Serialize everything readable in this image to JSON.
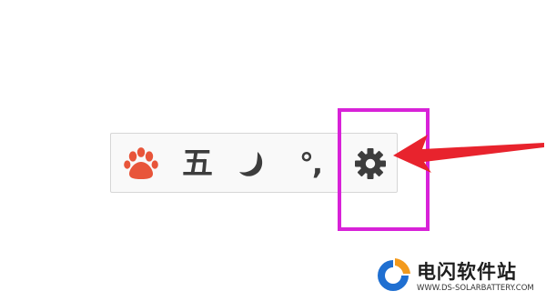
{
  "toolbar": {
    "wubi_label": "五",
    "punctuation_label": "°,"
  },
  "colors": {
    "paw": "#e8553a",
    "icon_dark": "#3d3d3d",
    "highlight": "#d822d8",
    "arrow": "#e8232d",
    "toolbar_border": "#d6d6d6",
    "toolbar_bg": "#f9f9f9",
    "logo_blue": "#1f6fd1",
    "logo_orange": "#f39a1d"
  },
  "icons": {
    "ime_logo": "paw-icon",
    "moon": "moon-icon",
    "settings": "gear-icon"
  },
  "watermark": {
    "title": "电闪软件站",
    "domain": "WWW.DS-SOLARBATTERY.COM"
  }
}
